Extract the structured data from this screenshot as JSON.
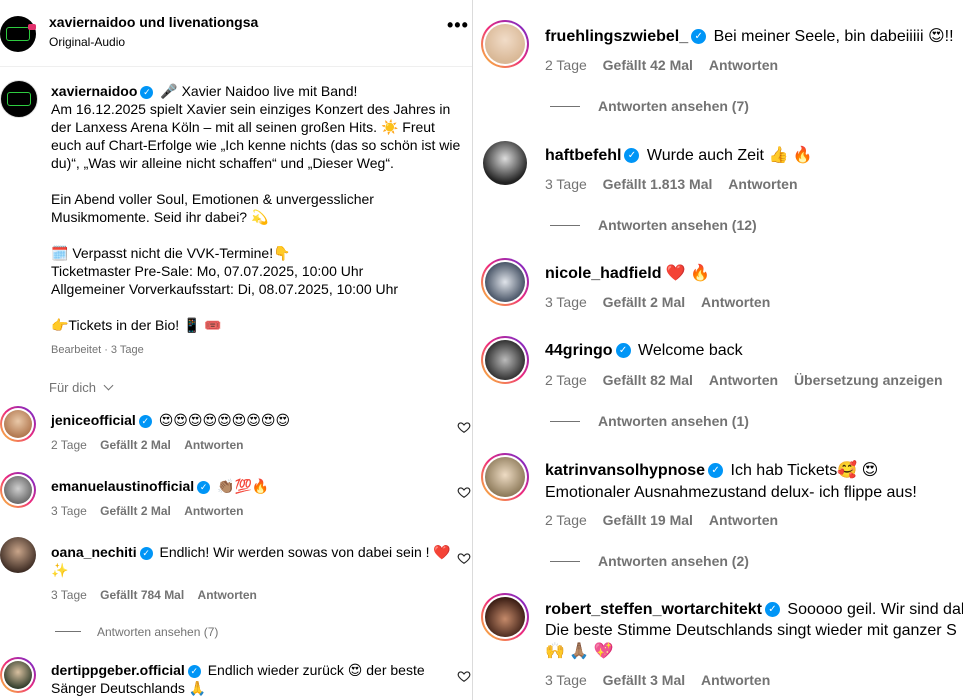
{
  "header": {
    "authors": "xaviernaidoo und livenationgsa",
    "audio": "Original-Audio",
    "more_icon": "more-dots-icon"
  },
  "post": {
    "username": "xaviernaidoo",
    "lines": [
      "🎤 Xavier Naidoo live mit Band!",
      "Am 16.12.2025 spielt Xavier sein einziges Konzert des Jahres in",
      "der Lanxess Arena Köln – mit all seinen großen Hits. ☀️ Freut",
      "euch auf Chart-Erfolge wie „Ich kenne nichts (das so schön ist wie",
      "du)“, „Was wir alleine nicht schaffen“ und „Dieser Weg“.",
      "Ein Abend voller Soul, Emotionen & unvergesslicher",
      "Musikmomente. Seid ihr dabei? 💫",
      "🗓️ Verpasst nicht die VVK-Termine!👇",
      "Ticketmaster Pre-Sale: Mo, 07.07.2025, 10:00 Uhr",
      "Allgemeiner Vorverkaufsstart: Di, 08.07.2025, 10:00 Uhr",
      "👉Tickets in der Bio! 📱 🎟️"
    ],
    "edited": "Bearbeitet · 3 Tage"
  },
  "filter": "Für dich",
  "left_comments": [
    {
      "user": "jeniceofficial",
      "text": "😍😍😍😍😍😍😍😍😍",
      "time": "2 Tage",
      "likes": "Gefällt 2 Mal",
      "reply": "Antworten"
    },
    {
      "user": "emanuelaustinofficial",
      "text": "👏🏽💯🔥",
      "time": "3 Tage",
      "likes": "Gefällt 2 Mal",
      "reply": "Antworten"
    },
    {
      "user": "oana_nechiti",
      "text": "Endlich! Wir werden sowas von dabei sein ! ❤️",
      "text2": "✨",
      "time": "3 Tage",
      "likes": "Gefällt 784 Mal",
      "reply": "Antworten",
      "view_replies": "Antworten ansehen (7)"
    },
    {
      "user": "dertippgeber.official",
      "text": "Endlich wieder zurück 😍 der beste",
      "text2": "Sänger Deutschlands 🙏"
    }
  ],
  "right_comments": [
    {
      "user": "fruehlingszwiebel_",
      "text": "Bei meiner Seele, bin dabeiiiii 😍!!",
      "time": "2 Tage",
      "likes": "Gefällt 42 Mal",
      "reply": "Antworten",
      "view_replies": "Antworten ansehen (7)"
    },
    {
      "user": "haftbefehl",
      "text": "Wurde auch Zeit 👍 🔥",
      "time": "3 Tage",
      "likes": "Gefällt 1.813 Mal",
      "reply": "Antworten",
      "view_replies": "Antworten ansehen (12)"
    },
    {
      "user": "nicole_hadfield",
      "text": "❤️ 🔥",
      "time": "3 Tage",
      "likes": "Gefällt 2 Mal",
      "reply": "Antworten"
    },
    {
      "user": "44gringo",
      "text": "Welcome back",
      "time": "2 Tage",
      "likes": "Gefällt 82 Mal",
      "reply": "Antworten",
      "translate": "Übersetzung anzeigen",
      "view_replies": "Antworten ansehen (1)"
    },
    {
      "user": "katrinvansolhypnose",
      "text": "Ich hab Tickets🥰 😍",
      "text2": "Emotionaler Ausnahmezustand delux- ich flippe aus!",
      "time": "2 Tage",
      "likes": "Gefällt 19 Mal",
      "reply": "Antworten",
      "view_replies": "Antworten ansehen (2)"
    },
    {
      "user": "robert_steffen_wortarchitekt",
      "text": "Sooooo geil. Wir sind dab",
      "text2": "Die beste Stimme Deutschlands singt wieder mit ganzer S",
      "text3": "🙌 🙏🏽 💖",
      "time": "3 Tage",
      "likes": "Gefällt 3 Mal",
      "reply": "Antworten"
    }
  ],
  "colors": {
    "verified": "#0095f6",
    "muted": "#737373",
    "ring_start": "#f9ce34",
    "ring_end": "#6228d7"
  }
}
